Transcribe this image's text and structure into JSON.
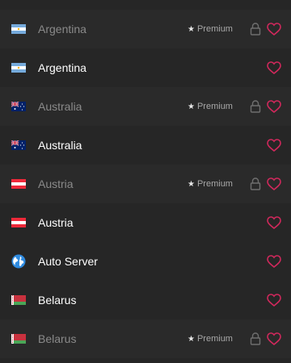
{
  "theme": {
    "background": "#262626",
    "heart_color": "#d1285c",
    "premium_text_color": "#8a8a8a"
  },
  "servers": [
    {
      "name": "Argentina",
      "flag": "argentina-flag",
      "premium": true,
      "premium_label": "Premium"
    },
    {
      "name": "Argentina",
      "flag": "argentina-flag",
      "premium": false
    },
    {
      "name": "Australia",
      "flag": "australia-flag",
      "premium": true,
      "premium_label": "Premium"
    },
    {
      "name": "Australia",
      "flag": "australia-flag",
      "premium": false
    },
    {
      "name": "Austria",
      "flag": "austria-flag",
      "premium": true,
      "premium_label": "Premium"
    },
    {
      "name": "Austria",
      "flag": "austria-flag",
      "premium": false
    },
    {
      "name": "Auto Server",
      "flag": "globe-icon",
      "premium": false
    },
    {
      "name": "Belarus",
      "flag": "belarus-flag",
      "premium": false
    },
    {
      "name": "Belarus",
      "flag": "belarus-flag",
      "premium": true,
      "premium_label": "Premium"
    }
  ]
}
